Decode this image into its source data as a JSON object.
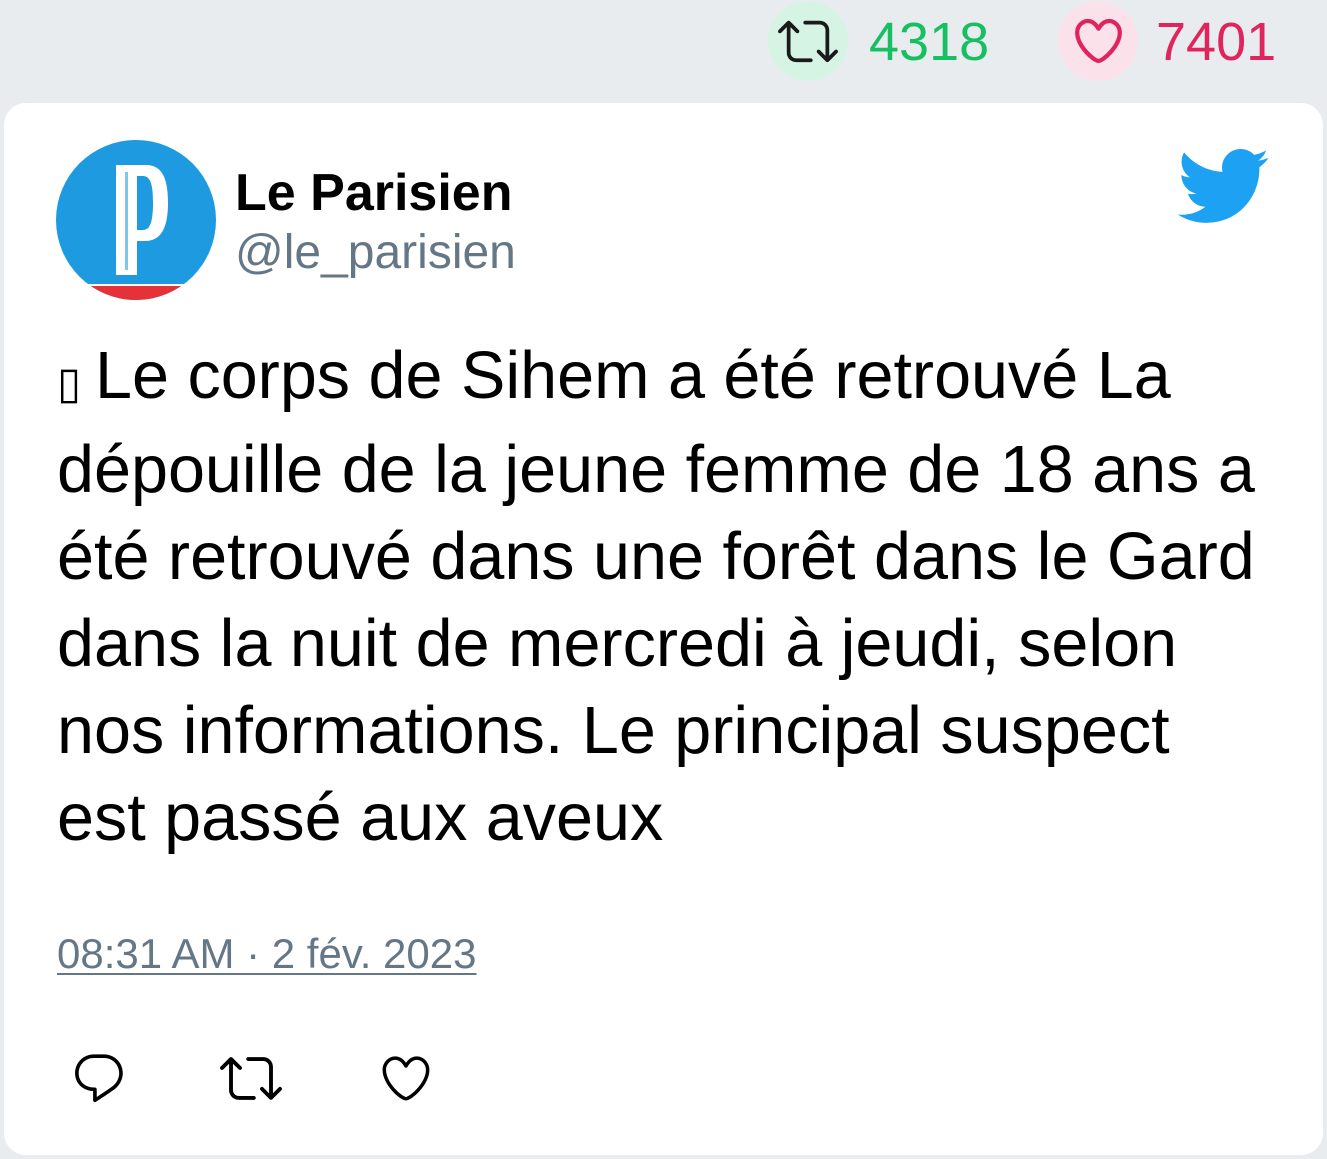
{
  "stats": {
    "retweet": {
      "icon": "retweet-icon",
      "count": "4318",
      "color": "#17bf63",
      "bg": "#d5f4e4"
    },
    "like": {
      "icon": "heart-icon",
      "count": "7401",
      "color": "#e0245e",
      "bg": "#fbe1ea"
    }
  },
  "author": {
    "name": "Le Parisien",
    "handle": "@le_parisien",
    "avatar": {
      "logo_letter": "P",
      "bg_color": "#1e9be0",
      "band_color": "#e53238"
    }
  },
  "brand": {
    "icon": "twitter-bird-icon",
    "color": "#1da1f2"
  },
  "tweet": {
    "lead_glyph": "▯",
    "lines": [
      "Le corps de Sihem a été retrouvé La",
      "dépouille de la jeune femme de 18 ans a",
      "été retrouvé dans une forêt dans le Gard",
      "dans la nuit de mercredi à jeudi, selon",
      "nos informations. Le principal suspect",
      "est passé aux aveux"
    ]
  },
  "timestamp": "08:31 AM · 2 fév. 2023",
  "actions": [
    {
      "icon": "reply-icon"
    },
    {
      "icon": "retweet-icon"
    },
    {
      "icon": "heart-icon"
    }
  ],
  "colors": {
    "text": "#000000",
    "muted": "#657786",
    "page_bg": "#e9ecef",
    "card_bg": "#ffffff"
  }
}
